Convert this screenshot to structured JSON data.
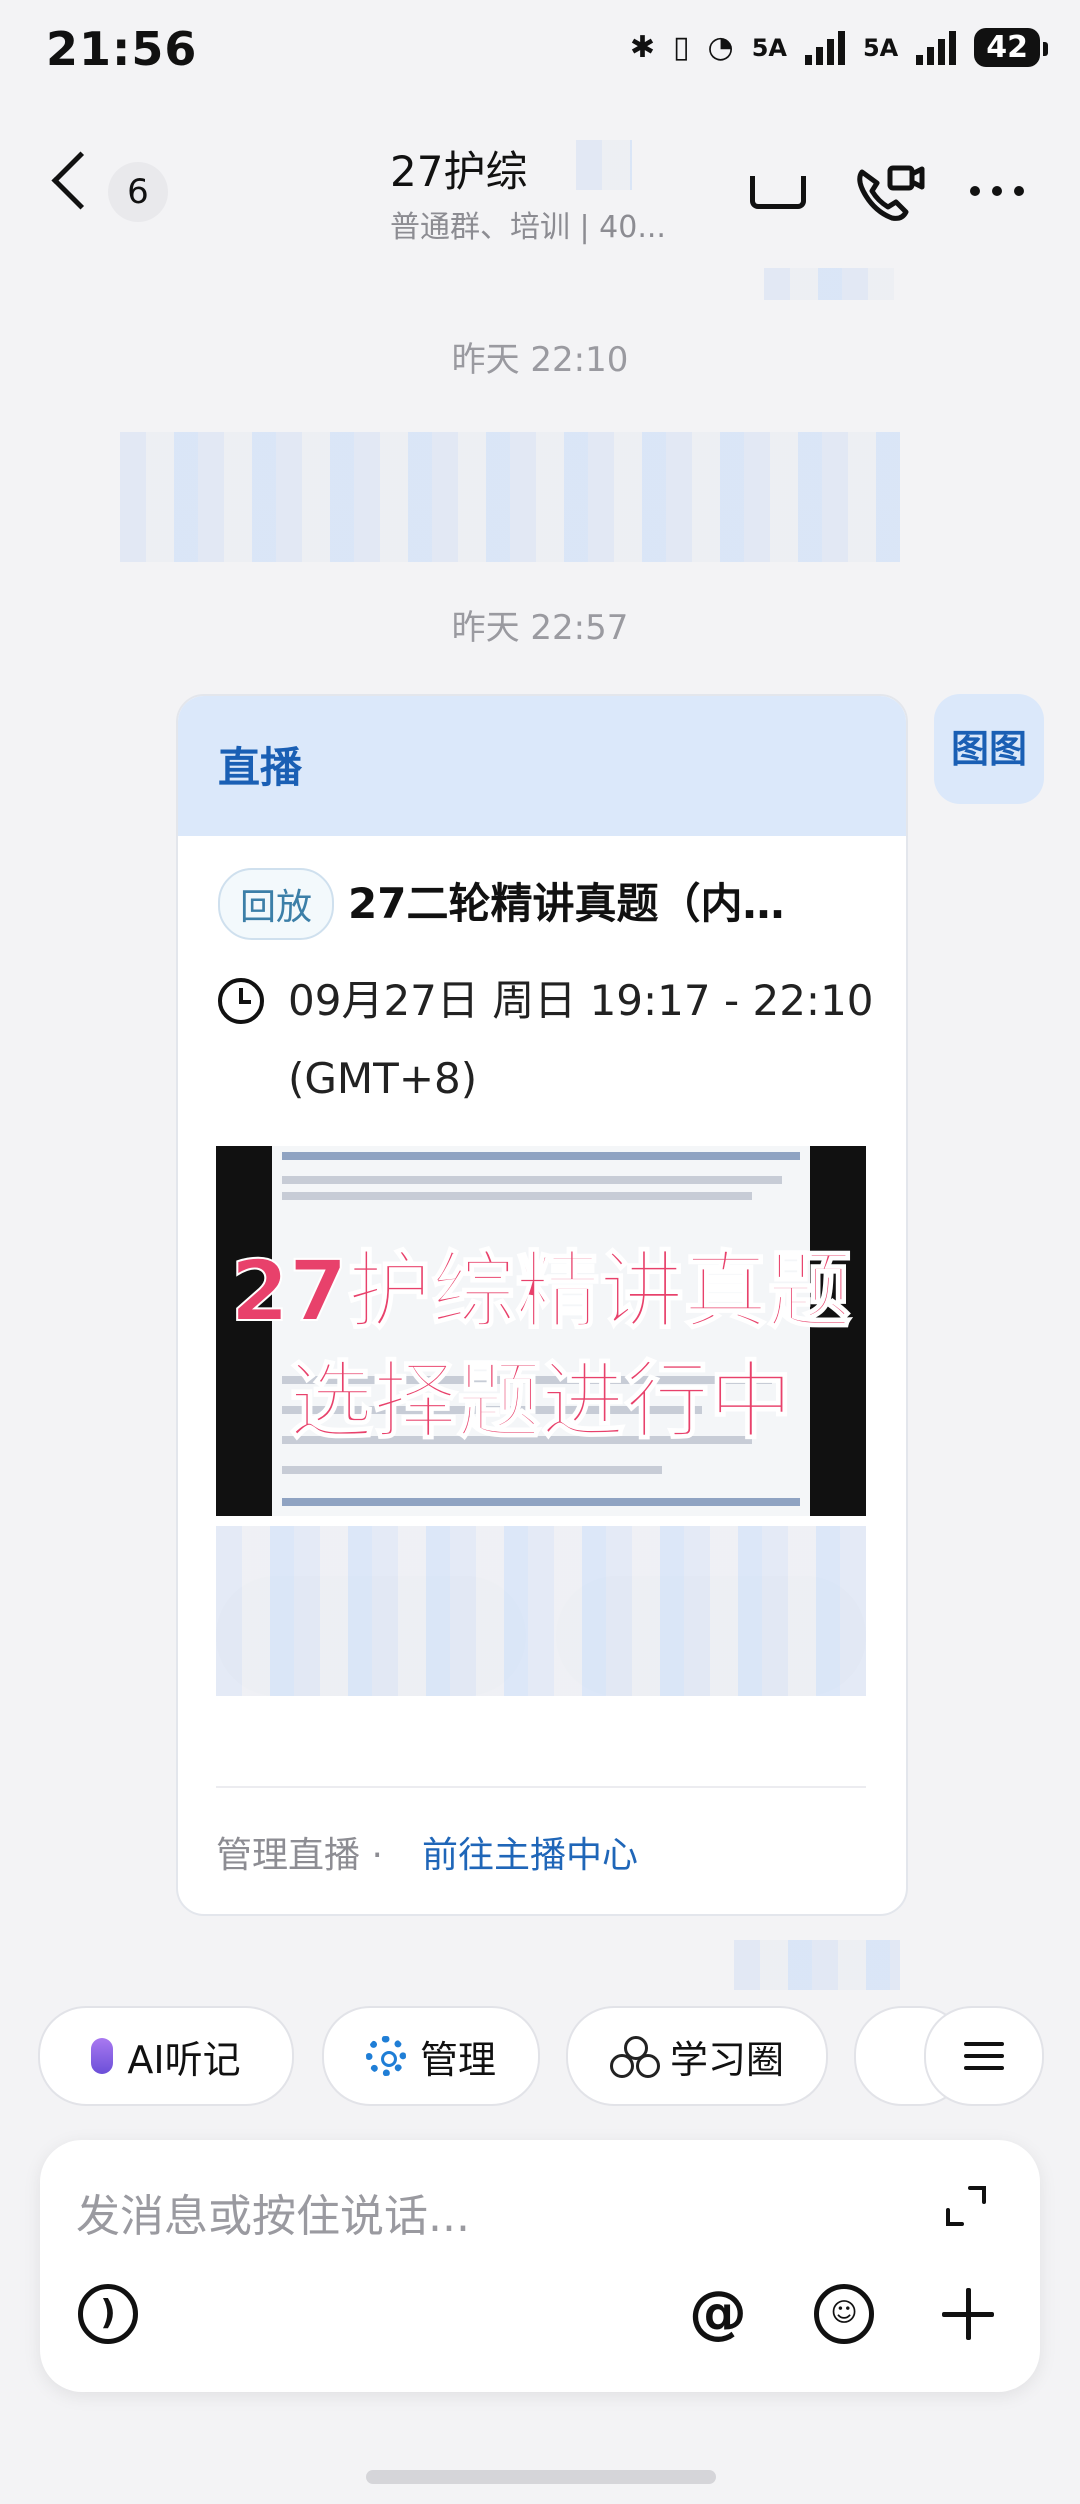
{
  "status_bar": {
    "time": "21:56",
    "network1": "5A",
    "network2": "5A",
    "battery": "42"
  },
  "header": {
    "back_count": "6",
    "title": "27护综",
    "subtitle": "普通群、培训 | 40..."
  },
  "messages": {
    "timestamp1": "昨天 22:10",
    "timestamp2": "昨天 22:57"
  },
  "live_card": {
    "header_label": "直播",
    "tag": "回放",
    "title": "27二轮精讲真题（内…",
    "time": "09月27日 周日 19:17 - 22:10 (GMT+8)",
    "thumbnail_text_line1": "27护综精讲真题",
    "thumbnail_text_line2": "选择题进行中",
    "footer_label": "管理直播",
    "footer_sep": "·",
    "footer_link": "前往主播中心"
  },
  "sender_avatar_text": "图图",
  "quick_actions": [
    {
      "label": "AI听记"
    },
    {
      "label": "管理"
    },
    {
      "label": "学习圈"
    }
  ],
  "input": {
    "placeholder": "发消息或按住说话..."
  },
  "colors": {
    "accent": "#1f66b8",
    "card_header": "#dbe8fa",
    "thumbnail_text": "#e8416b"
  }
}
